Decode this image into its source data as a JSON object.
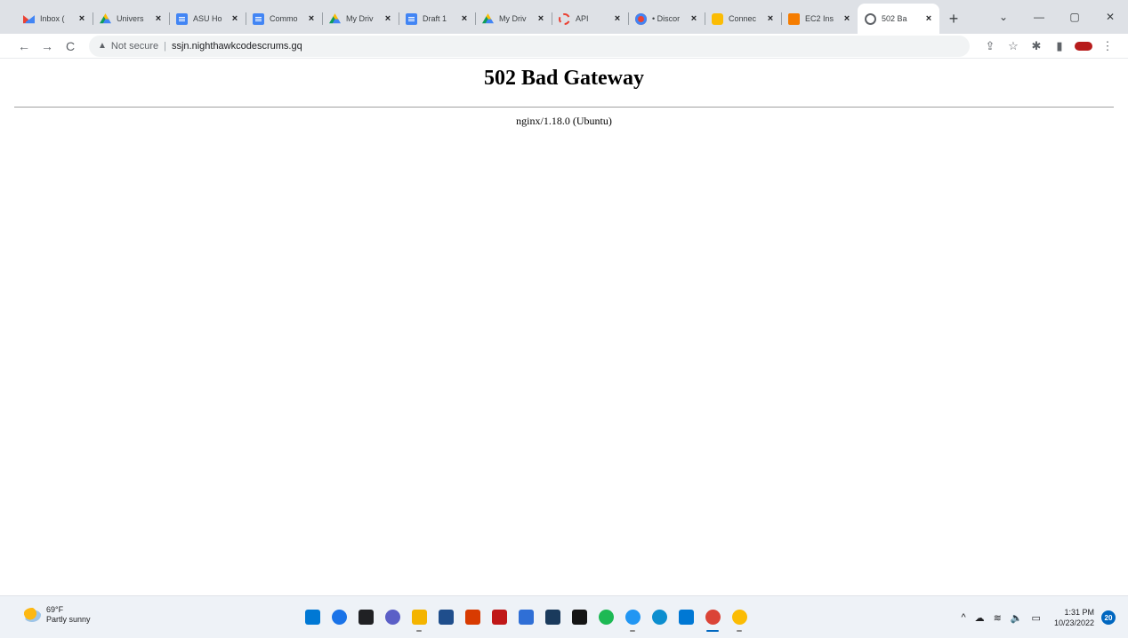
{
  "browser": {
    "tabs": [
      {
        "title": "Inbox (",
        "icon": "gmail-icon",
        "favclass": "fav-gmail"
      },
      {
        "title": "Univers",
        "icon": "google-drive-icon",
        "favclass": "fav-drive"
      },
      {
        "title": "ASU Ho",
        "icon": "google-docs-icon",
        "favclass": "fav-docs"
      },
      {
        "title": "Commo",
        "icon": "google-docs-icon",
        "favclass": "fav-docs"
      },
      {
        "title": "My Driv",
        "icon": "google-drive-icon",
        "favclass": "fav-drive"
      },
      {
        "title": "Draft 1",
        "icon": "google-docs-icon",
        "favclass": "fav-docs"
      },
      {
        "title": "My Driv",
        "icon": "google-drive-icon",
        "favclass": "fav-drive"
      },
      {
        "title": "API",
        "icon": "api-icon",
        "favclass": "fav-api"
      },
      {
        "title": "• Discor",
        "icon": "discord-icon",
        "favclass": "fav-disc"
      },
      {
        "title": "Connec",
        "icon": "connect-icon",
        "favclass": "fav-conn"
      },
      {
        "title": "EC2 Ins",
        "icon": "aws-ec2-icon",
        "favclass": "fav-ec2"
      },
      {
        "title": "502 Ba",
        "icon": "globe-icon",
        "favclass": "fav-globe",
        "active": true
      }
    ],
    "new_tab_glyph": "+",
    "window_controls": {
      "dropdown": "⌄",
      "minimize": "—",
      "restore": "▢",
      "close": "✕"
    },
    "nav": {
      "back": "←",
      "forward": "→",
      "reload": "C"
    },
    "address": {
      "security_glyph": "▲",
      "security_label": "Not secure",
      "separator": "|",
      "url": "ssjn.nighthawkcodescrums.gq"
    },
    "toolbar_icons": {
      "share": "⇪",
      "bookmark": "☆",
      "extensions": "✱",
      "sidepanel": "▮",
      "menu": "⋮"
    }
  },
  "page": {
    "heading": "502 Bad Gateway",
    "server": "nginx/1.18.0 (Ubuntu)"
  },
  "taskbar": {
    "weather": {
      "temp": "69°F",
      "condition": "Partly sunny"
    },
    "apps": [
      {
        "name": "start-button",
        "color": "#0078d4"
      },
      {
        "name": "search-icon",
        "color": "#1a73e8"
      },
      {
        "name": "task-view-icon",
        "color": "#202124"
      },
      {
        "name": "teams-chat-icon",
        "color": "#5b5fc7"
      },
      {
        "name": "file-explorer-icon",
        "color": "#f4b400",
        "running": true
      },
      {
        "name": "store-icon",
        "color": "#1f4e8c"
      },
      {
        "name": "office-icon",
        "color": "#d83b01"
      },
      {
        "name": "mcafee-icon",
        "color": "#c01818"
      },
      {
        "name": "calendar-icon",
        "color": "#2f6fd6"
      },
      {
        "name": "klondike-icon",
        "color": "#1a3a5c"
      },
      {
        "name": "netflix-icon",
        "color": "#141414"
      },
      {
        "name": "spotify-icon",
        "color": "#1db954"
      },
      {
        "name": "cloud-app-icon",
        "color": "#2196f3",
        "running": true
      },
      {
        "name": "edge-icon",
        "color": "#0c8ecf"
      },
      {
        "name": "vscode-icon",
        "color": "#0078d4"
      },
      {
        "name": "chrome-icon",
        "color": "#db4437",
        "running": true,
        "focused": true
      },
      {
        "name": "chrome-dev-icon",
        "color": "#fbbc04",
        "running": true
      }
    ],
    "tray": {
      "chevron": "^",
      "cloud": "☁",
      "wifi": "≋",
      "volume": "🔈",
      "battery": "▭",
      "time": "1:31 PM",
      "date": "10/23/2022",
      "notifications": "20"
    }
  }
}
